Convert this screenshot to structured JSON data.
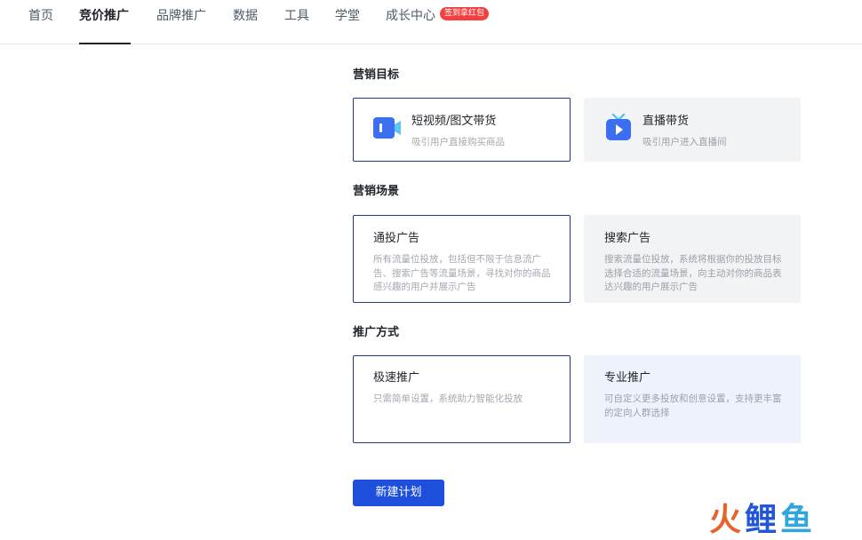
{
  "nav": {
    "items": [
      {
        "label": "首页",
        "active": false
      },
      {
        "label": "竞价推广",
        "active": true
      },
      {
        "label": "品牌推广",
        "active": false
      },
      {
        "label": "数据",
        "active": false
      },
      {
        "label": "工具",
        "active": false
      },
      {
        "label": "学堂",
        "active": false
      },
      {
        "label": "成长中心",
        "active": false
      }
    ],
    "badge": "签到拿红包"
  },
  "sections": {
    "goal": {
      "title": "营销目标",
      "options": [
        {
          "title": "短视频/图文带货",
          "desc": "吸引用户直接购买商品",
          "icon": "video-camera-icon",
          "selected": true
        },
        {
          "title": "直播带货",
          "desc": "吸引用户进入直播间",
          "icon": "live-tv-icon",
          "selected": false
        }
      ]
    },
    "scene": {
      "title": "营销场景",
      "options": [
        {
          "title": "通投广告",
          "desc": "所有流量位投放，包括但不限于信息流广告、搜索广告等流量场景，寻找对你的商品感兴趣的用户并展示广告",
          "selected": true
        },
        {
          "title": "搜索广告",
          "desc": "搜索流量位投放，系统将根据你的投放目标选择合适的流量场景，向主动对你的商品表达兴趣的用户展示广告",
          "selected": false
        }
      ]
    },
    "mode": {
      "title": "推广方式",
      "options": [
        {
          "title": "极速推广",
          "desc": "只需简单设置，系统助力智能化投放",
          "selected": true
        },
        {
          "title": "专业推广",
          "desc": "可自定义更多投放和创意设置，支持更丰富的定向人群选择",
          "selected": false
        }
      ]
    }
  },
  "actions": {
    "create_label": "新建计划"
  },
  "watermark": {
    "char1": "火",
    "char2": "鲤",
    "char3": "鱼"
  },
  "colors": {
    "accent": "#1e4fdc",
    "selected_border": "#1d3a8a",
    "badge": "#f53f3f"
  }
}
